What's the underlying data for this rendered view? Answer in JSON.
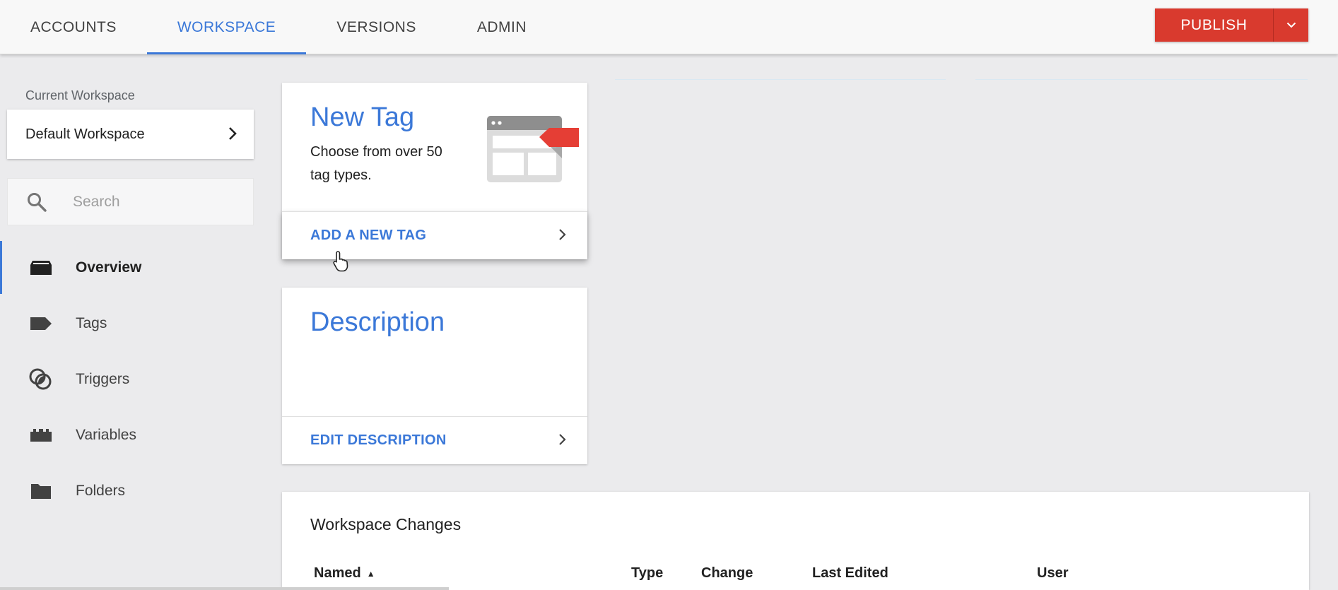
{
  "header": {
    "tabs": [
      {
        "label": "ACCOUNTS",
        "active": false
      },
      {
        "label": "WORKSPACE",
        "active": true
      },
      {
        "label": "VERSIONS",
        "active": false
      },
      {
        "label": "ADMIN",
        "active": false
      }
    ],
    "publish_label": "PUBLISH"
  },
  "sidebar": {
    "current_workspace_label": "Current Workspace",
    "workspace_name": "Default Workspace",
    "search_placeholder": "Search",
    "nav": [
      {
        "label": "Overview",
        "icon": "overview-icon",
        "active": true
      },
      {
        "label": "Tags",
        "icon": "tag-icon",
        "active": false
      },
      {
        "label": "Triggers",
        "icon": "trigger-icon",
        "active": false
      },
      {
        "label": "Variables",
        "icon": "variables-icon",
        "active": false
      },
      {
        "label": "Folders",
        "icon": "folder-icon",
        "active": false
      }
    ]
  },
  "new_tag_card": {
    "title": "New Tag",
    "text": "Choose from over 50 tag types.",
    "action": "ADD A NEW TAG"
  },
  "description_card": {
    "title": "Description",
    "action": "EDIT DESCRIPTION"
  },
  "workspace_changes": {
    "title": "Workspace Changes",
    "columns": {
      "named": "Named",
      "type": "Type",
      "change": "Change",
      "last_edited": "Last Edited",
      "user": "User"
    },
    "sort_indicator": "▲"
  },
  "colors": {
    "accent": "#3b78d8",
    "publish": "#d93a2e",
    "background": "#ebebed"
  }
}
